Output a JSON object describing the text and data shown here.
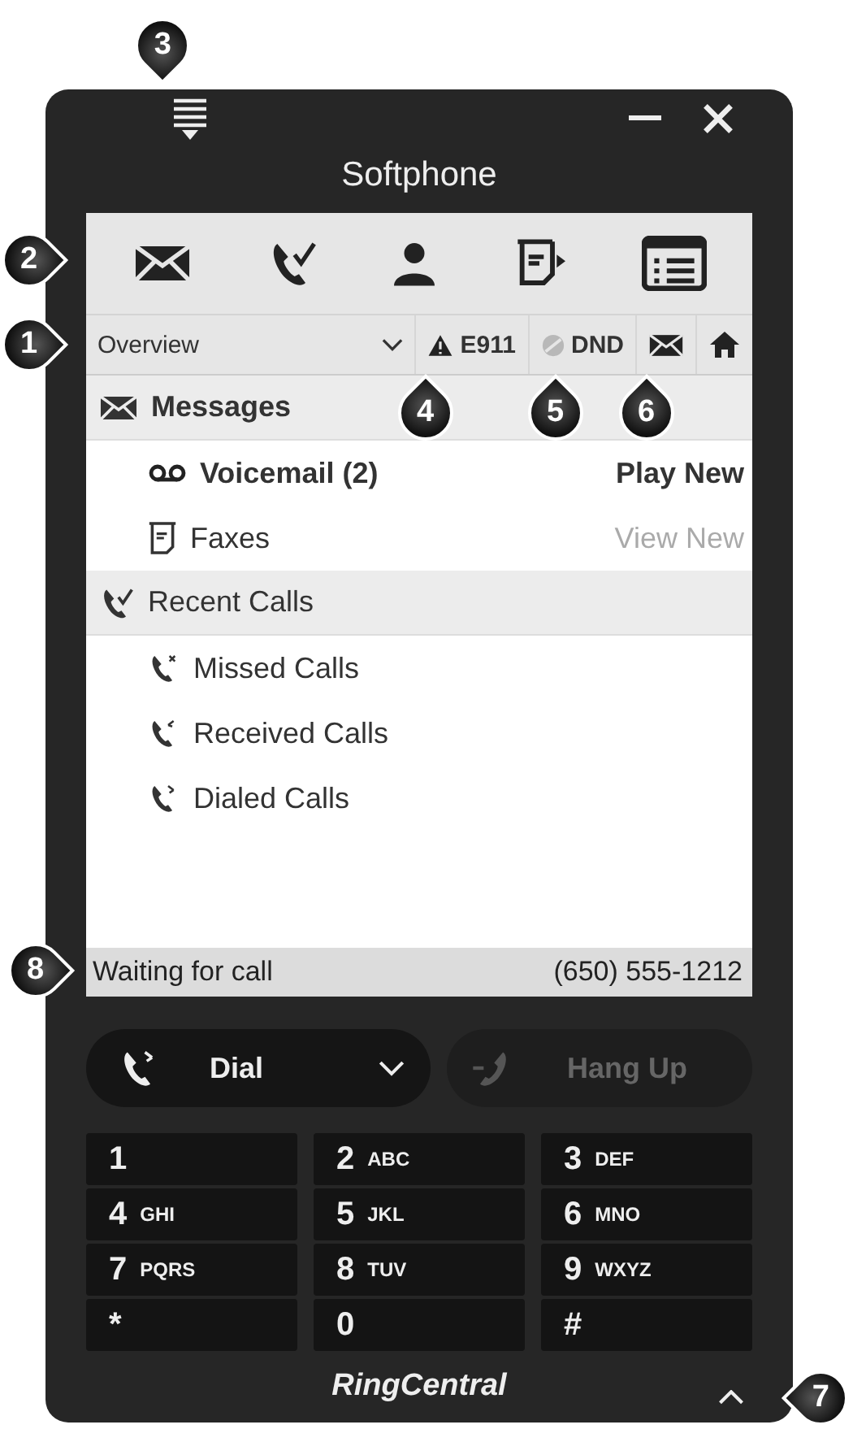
{
  "window": {
    "title": "Softphone"
  },
  "view_bar": {
    "view": "Overview",
    "e911": "E911",
    "dnd": "DND"
  },
  "sections": [
    {
      "title": "Messages",
      "kind": "messages",
      "highlighted": true,
      "items": [
        {
          "label": "Voicemail (2)",
          "kind": "voicemail",
          "highlighted": true,
          "action": "Play New",
          "action_disabled": false
        },
        {
          "label": "Faxes",
          "kind": "fax",
          "highlighted": false,
          "action": "View New",
          "action_disabled": true
        }
      ]
    },
    {
      "title": "Recent Calls",
      "kind": "calls",
      "highlighted": false,
      "items": [
        {
          "label": "Missed Calls",
          "kind": "missed",
          "highlighted": false
        },
        {
          "label": "Received Calls",
          "kind": "received",
          "highlighted": false
        },
        {
          "label": "Dialed Calls",
          "kind": "dialed",
          "highlighted": false
        }
      ]
    }
  ],
  "status_bar": {
    "status": "Waiting for call",
    "number": "(650) 555-1212"
  },
  "call_buttons": {
    "dial": {
      "label": "Dial",
      "disabled": false
    },
    "hang_up": {
      "label": "Hang Up",
      "disabled": true
    }
  },
  "keypad": [
    {
      "digit": "1"
    },
    {
      "digit": "2",
      "letters": "ABC"
    },
    {
      "digit": "3",
      "letters": "DEF"
    },
    {
      "digit": "4",
      "letters": "GHI"
    },
    {
      "digit": "5",
      "letters": "JKL"
    },
    {
      "digit": "6",
      "letters": "MNO"
    },
    {
      "digit": "7",
      "letters": "PQRS"
    },
    {
      "digit": "8",
      "letters": "TUV"
    },
    {
      "digit": "9",
      "letters": "WXYZ"
    },
    {
      "digit": "*"
    },
    {
      "digit": "0"
    },
    {
      "digit": "#"
    }
  ],
  "footer": {
    "brand": "RingCentral"
  },
  "callouts": [
    {
      "label": "3"
    },
    {
      "label": "2"
    },
    {
      "label": "1"
    },
    {
      "label": "4"
    },
    {
      "label": "5"
    },
    {
      "label": "6"
    },
    {
      "label": "8"
    },
    {
      "label": "7"
    }
  ]
}
